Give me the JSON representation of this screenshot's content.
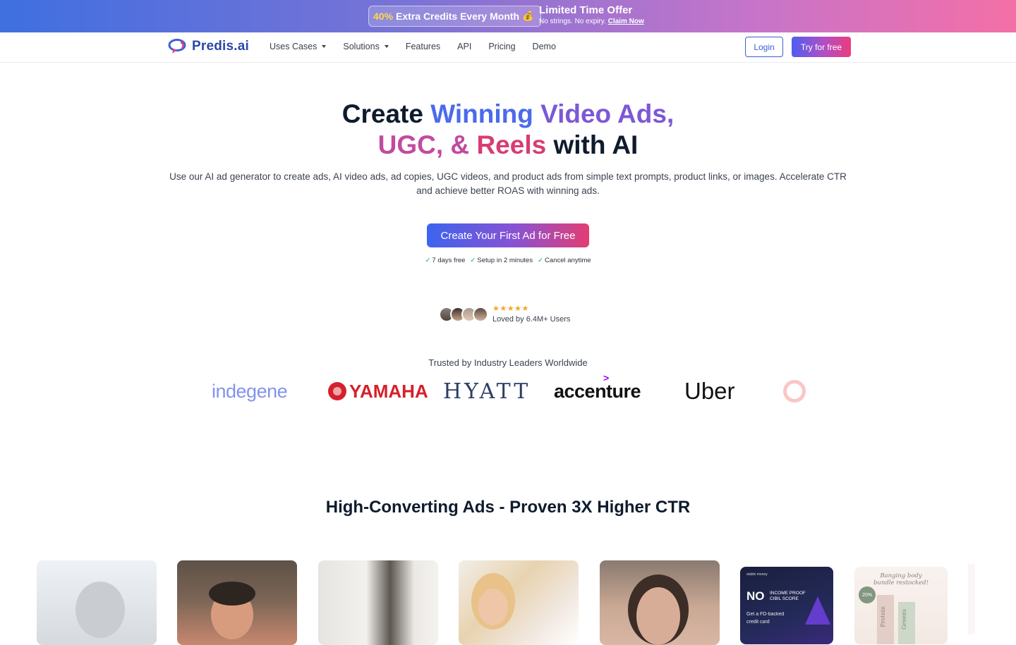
{
  "promo": {
    "pct": "40%",
    "pill_text": "Extra Credits  Every Month",
    "bag_icon": "💰",
    "title": "Limited Time Offer",
    "sub": "No strings. No expiry.",
    "claim": "Claim Now"
  },
  "nav": {
    "logo": "Predis.ai",
    "items": [
      "Uses Cases",
      "Solutions",
      "Features",
      "API",
      "Pricing",
      "Demo"
    ],
    "login": "Login",
    "try": "Try for free"
  },
  "hero": {
    "title_w1": "Create",
    "title_w2": "Winning",
    "title_w3": "Video Ads,",
    "title_w4": "UGC, &",
    "title_w5": "Reels",
    "title_w6": "with AI",
    "subtitle": "Use our AI ad generator to create ads, AI video ads, ad copies, UGC videos, and product ads from simple text prompts, product links, or images. Accelerate CTR and achieve better ROAS with winning ads.",
    "cta": "Create Your First Ad for Free",
    "checks": [
      "7 days free",
      "Setup in 2 minutes",
      "Cancel anytime"
    ],
    "stars": "★★★★★",
    "loved": "Loved by 6.4M+ Users"
  },
  "trusted": {
    "title": "Trusted by Industry Leaders Worldwide",
    "brands": [
      "indegene",
      "YAMAHA",
      "HYATT",
      "accenture",
      "Uber"
    ]
  },
  "section": {
    "title": "High-Converting Ads - Proven 3X Higher CTR"
  },
  "cards": {
    "c6_brand": "stable money",
    "c6_no": "NO",
    "c6_nosub1": "INCOME PROOF",
    "c6_nosub2": "CIBIL SCORE",
    "c6_fd1": "Get a FD-backed",
    "c6_fd2": "credit card",
    "c7_head1": "Banging body",
    "c7_head2": "bundle restocked!",
    "c7_badge": "20%",
    "c7_protein": "Protein",
    "c7_greens": "Greens"
  },
  "colors": {
    "accent_blue": "#4b6bec",
    "accent_pink": "#d73d74",
    "check_green": "#22a06b",
    "star": "#f5a623"
  }
}
